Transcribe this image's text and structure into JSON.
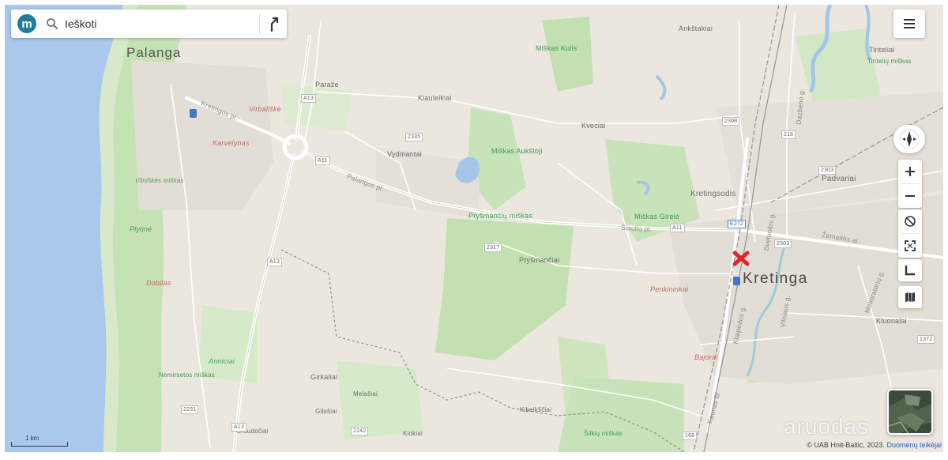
{
  "search": {
    "logo_letter": "m",
    "value": "Ieškoti"
  },
  "labels": {
    "palanga": "Palanga",
    "kretinga": "Kretinga",
    "parazė": "Paraže",
    "kiauleikiai": "Kiauleikiai",
    "vydmantai": "Vydmantai",
    "kveciai": "Kveciai",
    "ankstakiai": "Ankštakiai",
    "tinteliai": "Tinteliai",
    "tinteliu_miskas": "Tintelių miškas",
    "miskas_kulis": "Miškas Kulis",
    "miskas_aukstoji": "Miškas Aukštoji",
    "kretingsodis": "Kretingsodis",
    "padvariai": "Padvariai",
    "prysmanciu_miskas": "Pryšmančių miškas",
    "miskas_girele": "Miškas Girelė",
    "prysmanciai": "Pryšmančiai",
    "penkininkai": "Penkininkai",
    "kluonalai": "Kluonalai",
    "bajorai": "Bajorai",
    "virbaliske": "Virbališkė",
    "karvelynas": "Karvelynas",
    "vilniskes_miskas": "Vilniškės miškas",
    "plytine": "Plytinė",
    "dobilas": "Dobilas",
    "anniciai": "Anniciai",
    "nemirsetos_miskas": "Nemirsetos miškas",
    "girkaliai": "Girkaliai",
    "melasiai": "Melašiai",
    "gibisiai": "Gibišiai",
    "graudociai": "Graudočiai",
    "kibelksciai": "Kibelkščiai",
    "kiokiai": "Kiokiai",
    "silkiu_miskas": "Šilkių miškas",
    "kretingos_pl": "Kretingos pl.",
    "palangos_pl": "Palangos pl.",
    "siauliu_pl": "Šiaulių pl.",
    "zemaites_al": "Žemaitės al.",
    "vilniaus_g": "Vilniaus g.",
    "klaipedos_g": "Klaipėdos g.",
    "svetuolos_g": "Svetuolos g.",
    "dazbeno_g": "Dazbeno g.",
    "melioratoriu_g": "Melioratorių g.",
    "a13": "A13",
    "a11": "A11",
    "e272": "E272",
    "r2308": "2308",
    "r218": "218",
    "r2335": "2335",
    "r2317": "2317",
    "r2303": "2303",
    "r2303b": "2303",
    "r2242": "2242",
    "r2231": "2231",
    "r168": "168",
    "r1372": "1372",
    "kartena_partial": "Kaunas Bl"
  },
  "scale": {
    "label": "1 km"
  },
  "attribution": {
    "text": "© UAB Hnit-Baltic, 2023.",
    "link": "Duomenų teikėjai"
  },
  "watermark": "aruodas",
  "icons": {
    "menu": "hamburger-menu-icon",
    "compass": "compass-icon",
    "zoom_in": "plus-icon",
    "zoom_out": "minus-icon",
    "rotate": "rotate-icon",
    "fullscreen": "fullscreen-icon",
    "measure": "measure-icon",
    "layers": "map-layers-icon",
    "search": "search-icon",
    "directions": "directions-icon",
    "marker": "location-marker-icon"
  },
  "colors": {
    "marker": "#e0262b",
    "brand": "#1f7f9b",
    "water": "#a3c6e8",
    "forest": "#c8e3b9",
    "land": "#ebe7df"
  }
}
